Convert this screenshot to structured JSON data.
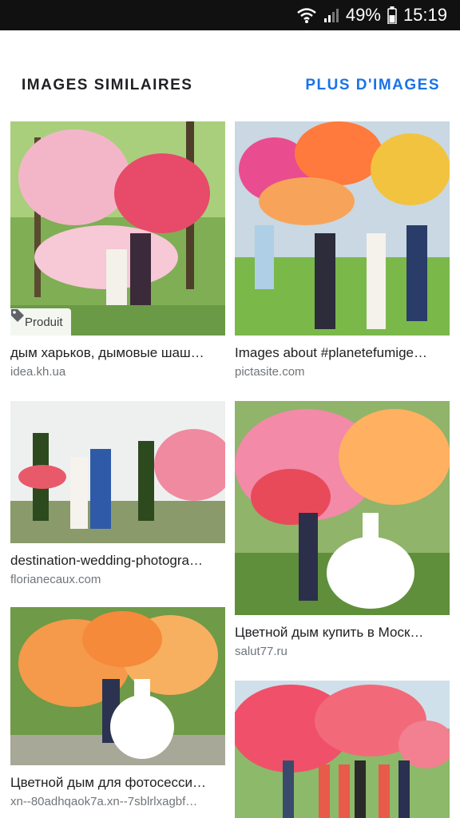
{
  "status_bar": {
    "battery": "49%",
    "time": "15:19",
    "icons": [
      "wifi-icon",
      "signal-icon",
      "battery-icon"
    ]
  },
  "section": {
    "title": "IMAGES SIMILAIRES",
    "more_label": "PLUS D'IMAGES",
    "accent_color": "#1a73e8"
  },
  "results": [
    {
      "caption": "дым харьков, дымовые шаш…",
      "source": "idea.kh.ua",
      "badge": "Produit",
      "badge_icon": "tag-icon"
    },
    {
      "caption": "Images about #planetefumige…",
      "source": "pictasite.com"
    },
    {
      "caption": "destination-wedding-photogra…",
      "source": "florianecaux.com"
    },
    {
      "caption": "Цветной дым купить в Моск…",
      "source": "salut77.ru"
    },
    {
      "caption": "Цветной дым для фотосесси…",
      "source": "xn--80adhqaok7a.xn--7sblrlxagbf…"
    },
    {
      "caption": "",
      "source": ""
    }
  ]
}
